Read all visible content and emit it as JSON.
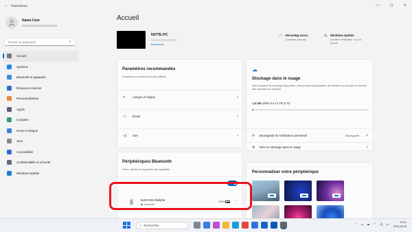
{
  "window": {
    "title": "Paramètres",
    "back_icon": "←",
    "controls": [
      "—",
      "▢",
      "✕"
    ]
  },
  "user": {
    "name": "Name User"
  },
  "search": {
    "placeholder": "Trouver un paramètre",
    "icon": "search-icon"
  },
  "sidebar": {
    "items": [
      {
        "label": "Accueil",
        "icon": "home-icon",
        "color": "#7a7a7a",
        "active": true
      },
      {
        "label": "Système",
        "icon": "system-icon",
        "color": "#1e88e5"
      },
      {
        "label": "Bluetooth et appareils",
        "icon": "bluetooth-icon",
        "color": "#3b8fd9"
      },
      {
        "label": "Réseau et Internet",
        "icon": "wifi-icon",
        "color": "#2d6fc9"
      },
      {
        "label": "Personnalisation",
        "icon": "brush-icon",
        "color": "#e38b3c"
      },
      {
        "label": "Applis",
        "icon": "apps-icon",
        "color": "#5a6478"
      },
      {
        "label": "Comptes",
        "icon": "account-icon",
        "color": "#2e9e6a"
      },
      {
        "label": "Heure et langue",
        "icon": "clock-language-icon",
        "color": "#3a86d6"
      },
      {
        "label": "Jeux",
        "icon": "gamepad-icon",
        "color": "#7f8c8d"
      },
      {
        "label": "Accessibilité",
        "icon": "accessibility-icon",
        "color": "#2b6cd1"
      },
      {
        "label": "Confidentialité et sécurité",
        "icon": "shield-icon",
        "color": "#606d7c"
      },
      {
        "label": "Windows Update",
        "icon": "update-icon",
        "color": "#1f7ad6"
      }
    ]
  },
  "main": {
    "title": "Accueil",
    "device": {
      "name": "NOTE-PC",
      "rename": "Renommer"
    },
    "status": {
      "wifi_name": "elecom5g-xxxxx",
      "wifi_sub": "Connecté, sécurisé",
      "update_title": "Windows Update",
      "update_sub": "Dernière vérification : il y a 6 heures"
    },
    "recommended": {
      "title": "Paramètres recommandés",
      "desc": "Paramètres récents et les plus utilisés",
      "rows": [
        {
          "label": "Langue et région",
          "icon": "language-icon",
          "glyph": "⟡"
        },
        {
          "label": "Écran",
          "icon": "display-icon",
          "glyph": "▭"
        },
        {
          "label": "Son",
          "icon": "speaker-icon",
          "glyph": "◁)"
        }
      ]
    },
    "bluetooth": {
      "title": "Périphériques Bluetooth",
      "desc": "Gérer, ajouter et supprimer des appareils",
      "toggle_label": "Bluetooth",
      "toggle_on": true,
      "device_name": "ELECOM shellpha",
      "device_status": "Connecté",
      "battery": "100%",
      "more": "···"
    },
    "cloud": {
      "title": "Stockage dans le nuage",
      "desc": "Avec l'espace de stockage disponible, vous pouvez sauvegarder des fichiers ou envoyer et recevoir des courriels sur Outlook.",
      "used_bold": "1,5 GB",
      "used_rest": " utilisé sur 10 TB (0 %)",
      "used_fraction": 0.01,
      "backup_label": "Sauvegarde de l'ordinateur personnel",
      "backup_status": "Sauvegardé",
      "manage_label": "Gérer le stockage dans le nuage"
    },
    "personalize": {
      "title": "Personnaliser votre périphérique"
    }
  },
  "taskbar": {
    "search_placeholder": "Rechercher",
    "clock_time": "16:31",
    "clock_date": "2024-08-28",
    "lang": "A",
    "apps": [
      {
        "name": "task-view-icon",
        "color": "#7d8796"
      },
      {
        "name": "widgets-icon",
        "color": "#3b7be0"
      },
      {
        "name": "copilot-icon",
        "color": "#c04fd1"
      },
      {
        "name": "file-explorer-icon",
        "color": "#f2b732"
      },
      {
        "name": "edge-icon",
        "color": "#1a9bd7"
      },
      {
        "name": "chrome-icon",
        "color": "#e0463a"
      },
      {
        "name": "store-icon",
        "color": "#2f76d9"
      },
      {
        "name": "mail-icon",
        "color": "#1b64c7"
      },
      {
        "name": "outlook-icon",
        "color": "#0a5bb5"
      },
      {
        "name": "settings-icon",
        "color": "#5c6570"
      }
    ]
  }
}
